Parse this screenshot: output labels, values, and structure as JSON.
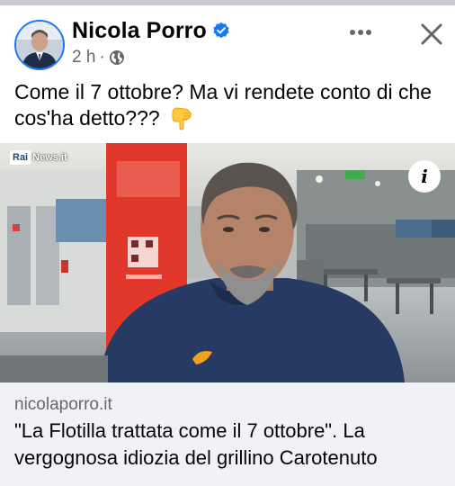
{
  "post": {
    "author": "Nicola Porro",
    "timestamp": "2 h",
    "separator": "·",
    "audience_icon": "globe-icon",
    "verified_icon": "verified-badge-icon",
    "text": "Come il 7 ottobre? Ma vi rendete conto di che cos'ha detto???",
    "emoji": "backhand-index-pointing-down-emoji"
  },
  "media": {
    "watermark_rai": "Rai",
    "watermark_news": "News.it",
    "info_label": "i"
  },
  "link": {
    "domain": "nicolaporro.it",
    "headline": "\"La Flotilla trattata come il 7 ottobre\". La vergognosa idiozia del grillino Carotenuto"
  },
  "colors": {
    "accent": "#1877f2",
    "secondary_text": "#65676b",
    "link_card_bg": "#f0f2f5"
  }
}
